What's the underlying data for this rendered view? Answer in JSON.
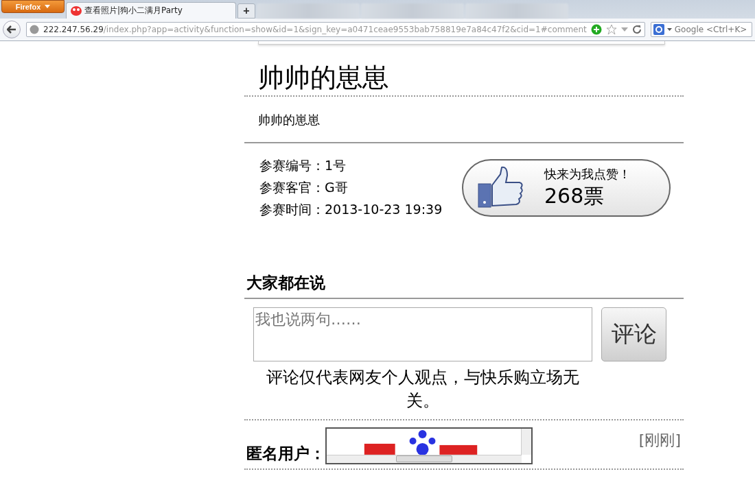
{
  "browser": {
    "menu_button": "Firefox",
    "tabs": [
      {
        "title": "查看照片|狗小二满月Party",
        "selected": true
      }
    ],
    "new_tab": "+",
    "address": {
      "host": "222.247.56.29",
      "path": "/index.php?app=activity&function=show&id=1&sign_key=a0471ceae9553bab758819e7a84c47f2&cid=1#comment"
    },
    "search": {
      "placeholder": "Google <Ctrl+K>"
    }
  },
  "photo": {
    "title": "帅帅的崽崽",
    "description": "帅帅的崽崽"
  },
  "details": [
    {
      "label": "参赛编号：",
      "value": "1号"
    },
    {
      "label": "参赛客官：",
      "value": "G哥"
    },
    {
      "label": "参赛时间：",
      "value": "2013-10-23 19:39"
    }
  ],
  "vote": {
    "prompt": "快来为我点赞！",
    "count": "268票"
  },
  "comments": {
    "heading": "大家都在说",
    "input": {
      "placeholder": "我也说两句……"
    },
    "submit": "评论",
    "notice": "评论仅代表网友个人观点，与快乐购立场无关。",
    "items": [
      {
        "author": "匿名用户：",
        "time": "[刚刚]"
      }
    ]
  }
}
